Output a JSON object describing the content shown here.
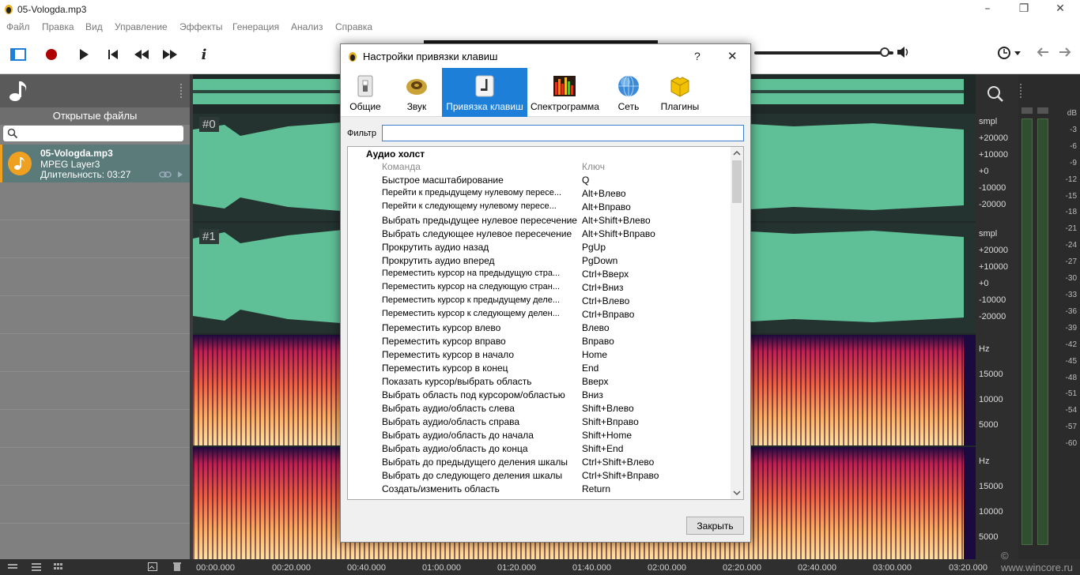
{
  "window": {
    "title": "05-Vologda.mp3",
    "controls": [
      "–",
      "❐",
      "✕"
    ]
  },
  "menu": [
    "Файл",
    "Правка",
    "Вид",
    "Управление",
    "Эффекты",
    "Генерация",
    "Анализ",
    "Справка"
  ],
  "toolbar": {
    "icons": [
      "view-panel-icon",
      "record-icon",
      "play-icon",
      "skip-start-icon",
      "rewind-icon",
      "fast-forward-icon",
      "info-icon"
    ],
    "info_glyph": "i",
    "volume_level": 0.94
  },
  "left_panel": {
    "header": "Открытые файлы",
    "search_placeholder": "",
    "file": {
      "name": "05-Vologda.mp3",
      "format": "MPEG Layer3",
      "duration": "Длительность: 03:27"
    }
  },
  "channels": [
    "#0",
    "#1"
  ],
  "scale": {
    "wave1": [
      "smpl",
      "+20000",
      "+10000",
      "+0",
      "-10000",
      "-20000"
    ],
    "wave2": [
      "smpl",
      "+20000",
      "+10000",
      "+0",
      "-10000",
      "-20000"
    ],
    "spec1": [
      "Hz",
      "15000",
      "10000",
      "5000"
    ],
    "spec2": [
      "Hz",
      "15000",
      "10000",
      "5000"
    ]
  },
  "meter_db": [
    "dB",
    "-3",
    "-6",
    "-9",
    "-12",
    "-15",
    "-18",
    "-21",
    "-24",
    "-27",
    "-30",
    "-33",
    "-36",
    "-39",
    "-42",
    "-45",
    "-48",
    "-51",
    "-54",
    "-57",
    "-60"
  ],
  "timeline": [
    "00:00.000",
    "00:20.000",
    "00:40.000",
    "01:00.000",
    "01:20.000",
    "01:40.000",
    "02:00.000",
    "02:20.000",
    "02:40.000",
    "03:00.000",
    "03:20.000"
  ],
  "watermark": "© www.wincore.ru",
  "dialog": {
    "title": "Настройки привязки клавиш",
    "help": "?",
    "close_x": "✕",
    "tabs": [
      {
        "label": "Общие",
        "icon": "switch-icon"
      },
      {
        "label": "Звук",
        "icon": "speaker-icon"
      },
      {
        "label": "Привязка клавиш",
        "icon": "key-icon",
        "active": true
      },
      {
        "label": "Спектрограмма",
        "icon": "spectrogram-icon"
      },
      {
        "label": "Сеть",
        "icon": "globe-icon"
      },
      {
        "label": "Плагины",
        "icon": "puzzle-icon"
      }
    ],
    "filter_label": "Фильтр",
    "filter_value": "",
    "group": "Аудио холст",
    "col_command": "Команда",
    "col_key": "Ключ",
    "bindings": [
      [
        "Быстрое масштабирование",
        "Q"
      ],
      [
        "Перейти к предыдущему нулевому пересе...",
        "Alt+Влево"
      ],
      [
        "Перейти к следующему нулевому пересе...",
        "Alt+Вправо"
      ],
      [
        "Выбрать предыдущее нулевое пересечение",
        "Alt+Shift+Влево"
      ],
      [
        "Выбрать следующее нулевое пересечение",
        "Alt+Shift+Вправо"
      ],
      [
        "Прокрутить аудио назад",
        "PgUp"
      ],
      [
        "Прокрутить аудио вперед",
        "PgDown"
      ],
      [
        "Переместить курсор на предыдущую стра...",
        "Ctrl+Вверх"
      ],
      [
        "Переместить курсор на следующую стран...",
        "Ctrl+Вниз"
      ],
      [
        "Переместить курсор к предыдущему деле...",
        "Ctrl+Влево"
      ],
      [
        "Переместить курсор к следующему делен...",
        "Ctrl+Вправо"
      ],
      [
        "Переместить курсор влево",
        "Влево"
      ],
      [
        "Переместить курсор вправо",
        "Вправо"
      ],
      [
        "Переместить курсор в начало",
        "Home"
      ],
      [
        "Переместить курсор в конец",
        "End"
      ],
      [
        "Показать курсор/выбрать область",
        "Вверх"
      ],
      [
        "Выбрать область под курсором/областью",
        "Вниз"
      ],
      [
        "Выбрать аудио/область слева",
        "Shift+Влево"
      ],
      [
        "Выбрать аудио/область справа",
        "Shift+Вправо"
      ],
      [
        "Выбрать аудио/область до начала",
        "Shift+Home"
      ],
      [
        "Выбрать аудио/область до конца",
        "Shift+End"
      ],
      [
        "Выбрать до предыдущего деления шкалы",
        "Ctrl+Shift+Влево"
      ],
      [
        "Выбрать до следующего деления шкалы",
        "Ctrl+Shift+Вправо"
      ],
      [
        "Создать/изменить область",
        "Return"
      ]
    ],
    "close_button": "Закрыть",
    "colors": {
      "active_tab": "#1e7fd8"
    }
  },
  "colors": {
    "waveform": "#5fbf96",
    "wave_bg": "#1f2a28",
    "file_accent": "#f0a020",
    "spectrum_hot": "#ffd27a"
  }
}
